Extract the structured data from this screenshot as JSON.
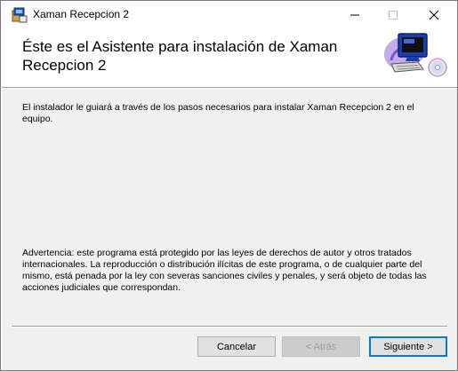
{
  "window": {
    "title": "Xaman Recepcion 2",
    "controls": {
      "minimize": "—",
      "maximize": "☐",
      "close": "✕"
    }
  },
  "header": {
    "title": "Éste es el Asistente para instalación de Xaman Recepcion 2"
  },
  "body": {
    "intro": "El instalador le guiará a través de los pasos necesarios para instalar Xaman Recepcion 2 en el equipo.",
    "warning": "Advertencia: este programa está protegido por las leyes de derechos de autor y otros tratados internacionales. La reproducción o distribución ilícitas de este programa, o de cualquier parte del mismo, está penada por la ley con severas sanciones civiles y penales, y será objeto de todas las acciones judiciales que correspondan."
  },
  "footer": {
    "cancel_label": "Cancelar",
    "back_label": "< Atrás",
    "next_label": "Siguiente >"
  },
  "colors": {
    "accent": "#0078d7",
    "panel": "#f0f0f0",
    "monitor": "#1a3fa8"
  },
  "icons": {
    "app": "installer-app-icon",
    "header": "computer-install-icon"
  }
}
